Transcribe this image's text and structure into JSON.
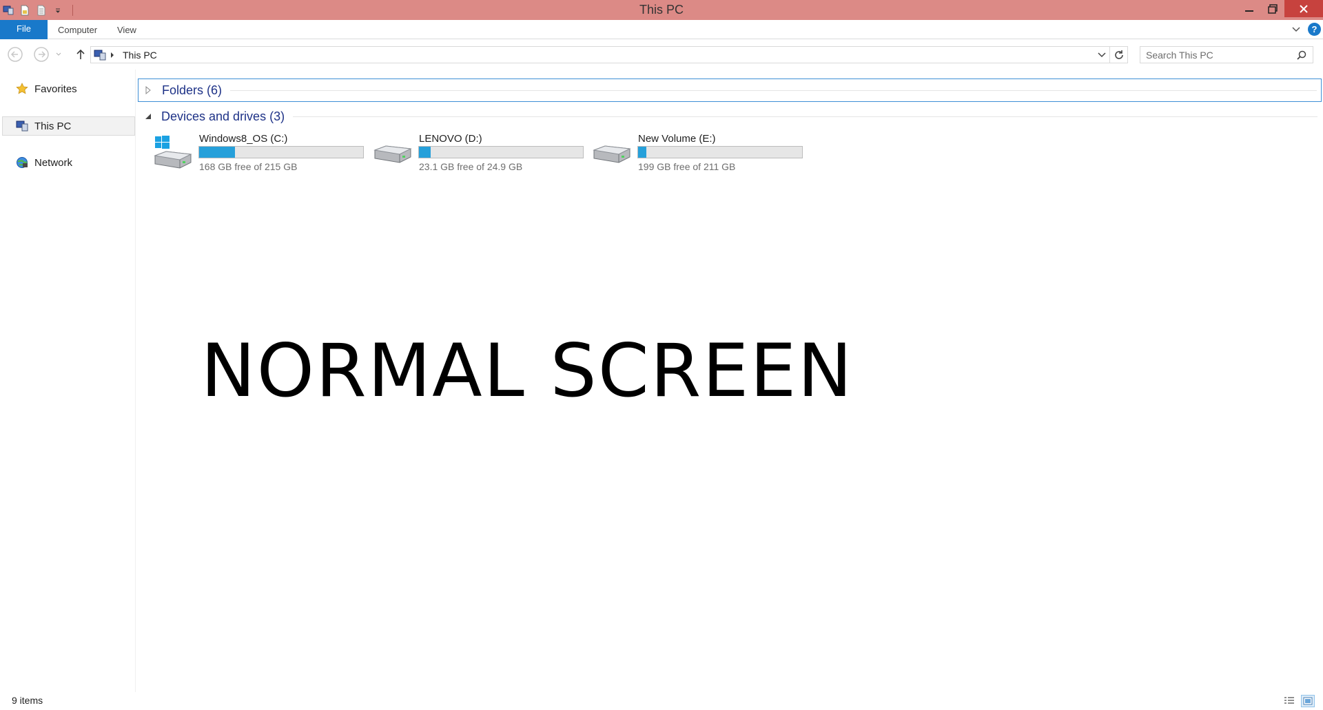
{
  "window": {
    "title": "This PC",
    "titlebar_color": "#dc8a86",
    "close_color": "#c7423e"
  },
  "quick_access": {
    "icons": [
      "this-pc-icon",
      "properties-icon",
      "new-folder-icon",
      "customize-dropdown-icon"
    ]
  },
  "ribbon": {
    "file_label": "File",
    "tabs": [
      "Computer",
      "View"
    ],
    "accent": "#1979ca",
    "help_label": "?"
  },
  "address": {
    "crumb": "This PC",
    "search_placeholder": "Search This PC"
  },
  "nav": {
    "items": [
      {
        "label": "Favorites",
        "icon": "star-icon"
      },
      {
        "label": "This PC",
        "icon": "this-pc-icon",
        "selected": true
      },
      {
        "label": "Network",
        "icon": "network-icon"
      }
    ]
  },
  "groups": {
    "folders": "Folders (6)",
    "devices": "Devices and drives (3)"
  },
  "drives": [
    {
      "name": "Windows8_OS (C:)",
      "free": "168 GB free of 215 GB",
      "used_fraction": 0.22,
      "icon": "windows-drive-icon"
    },
    {
      "name": "LENOVO (D:)",
      "free": "23.1 GB free of 24.9 GB",
      "used_fraction": 0.07,
      "icon": "hard-drive-icon"
    },
    {
      "name": "New Volume (E:)",
      "free": "199 GB free of 211 GB",
      "used_fraction": 0.05,
      "icon": "hard-drive-icon"
    }
  ],
  "overlay": "NORMAL SCREEN",
  "status": {
    "count": "9 items"
  },
  "colors": {
    "bar_fill": "#26a0da",
    "group_header": "#1e3287"
  }
}
